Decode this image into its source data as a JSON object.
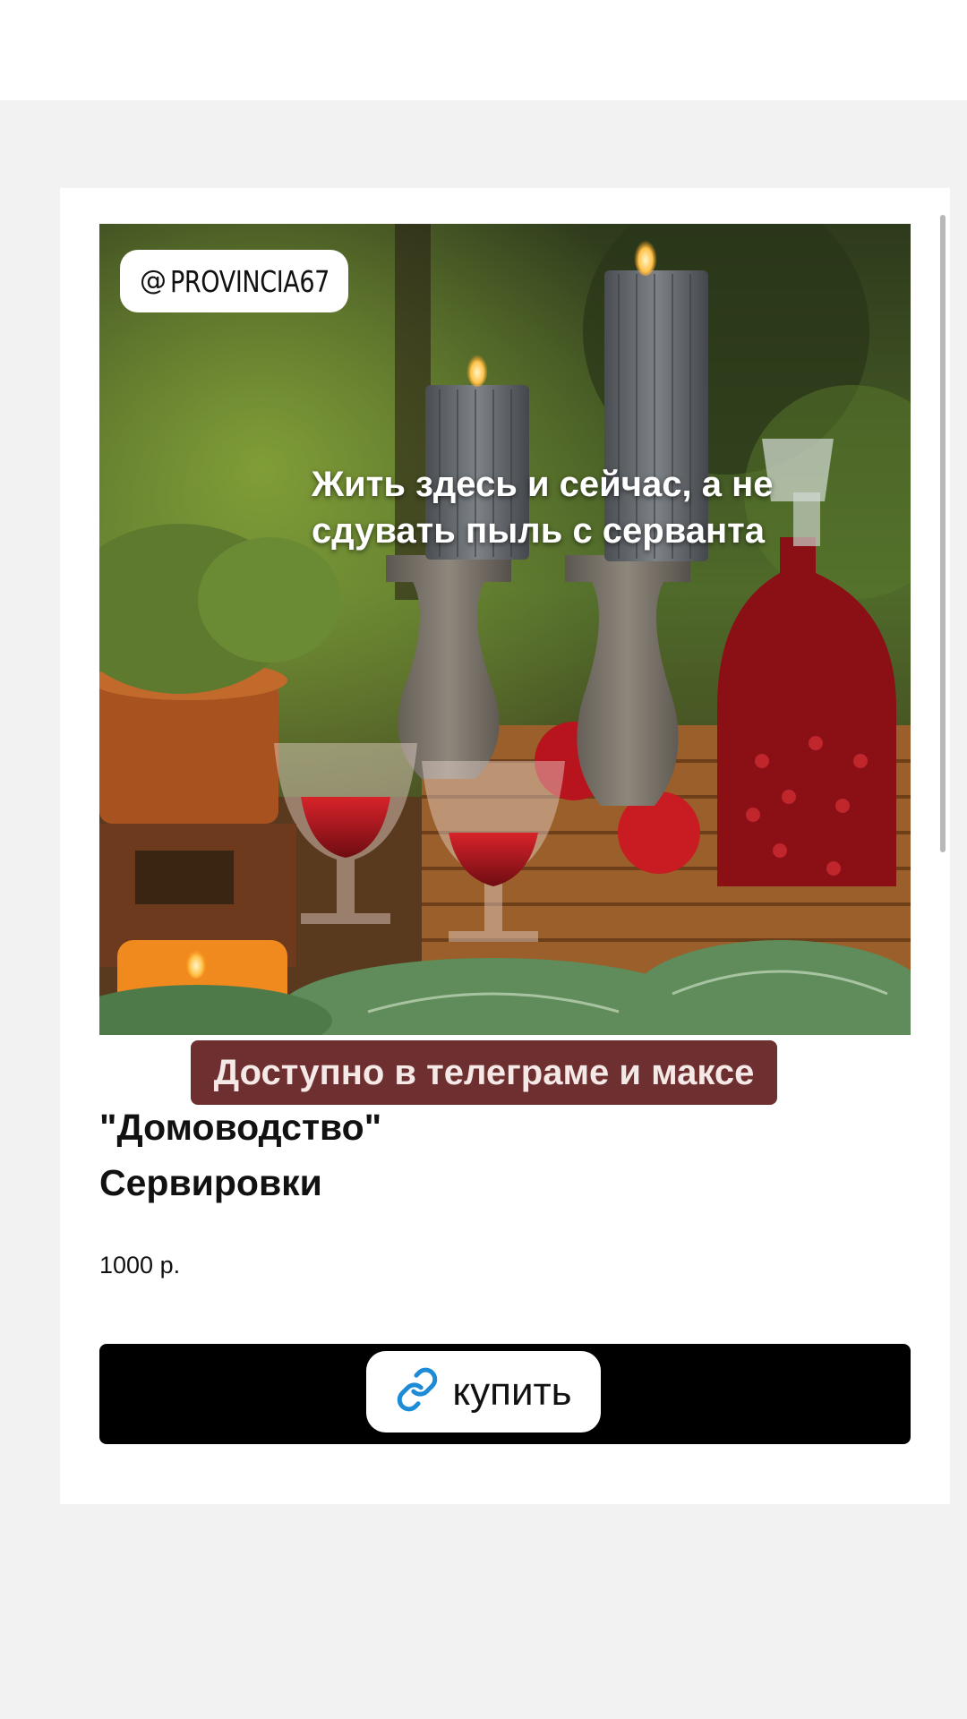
{
  "story": {
    "handle": "PROVINCIA67",
    "overlay_quote": "Жить здесь и сейчас, а не\nсдувать пыль с серванта",
    "banner_text": "Доступно в телеграме и максе",
    "buy_label": "купить",
    "link_icon": "link-icon",
    "threads_icon": "threads-icon"
  },
  "product": {
    "title_line1": "\"Домоводство\"",
    "title_line2": "Сервировки",
    "price": "1000 р.",
    "image_description_icon": "still-life-photo"
  },
  "colors": {
    "banner": "#6e2f30",
    "buy_bar": "#000000",
    "link_icon": "#1e8bd6"
  }
}
